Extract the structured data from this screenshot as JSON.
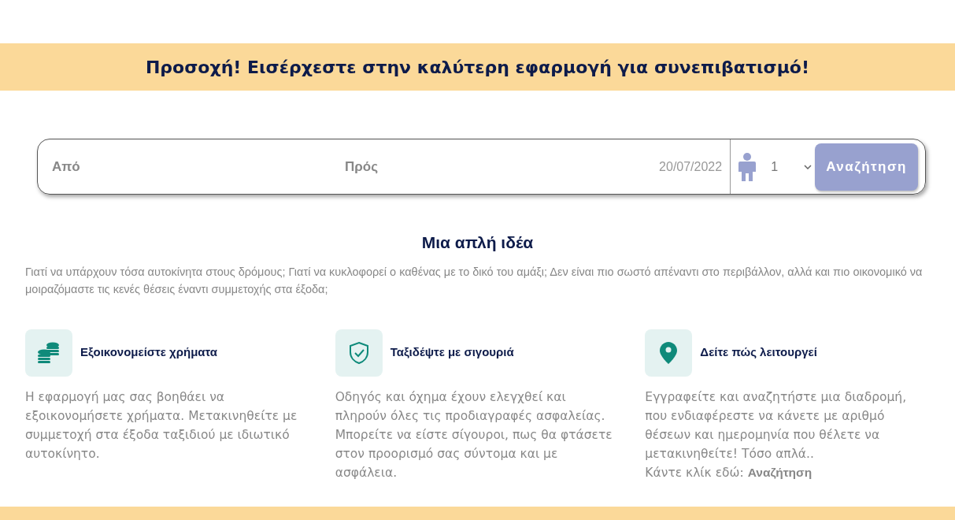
{
  "banner": {
    "text": "Προσοχή! Εισέρχεστε στην καλύτερη εφαρμογή για συνεπιβατισμό!"
  },
  "search": {
    "from_placeholder": "Από",
    "to_placeholder": "Πρός",
    "date": "20/07/2022",
    "passengers": "1",
    "button": "Αναζήτηση"
  },
  "intro": {
    "title": "Μια απλή ιδέα",
    "text": "Γιατί να υπάρχουν τόσα αυτοκίνητα στους δρόμους; Γιατί να κυκλοφορεί ο καθένας με το δικό του αμάξι; Δεν είναι πιο σωστό απέναντι στο περιβάλλον, αλλά και πιο οικονομικό να μοιραζόμαστε τις κενές θέσεις έναντι συμμετοχής στα έξοδα;"
  },
  "features": [
    {
      "kind": "coins",
      "title": "Εξοικονομείστε χρήματα",
      "body": "Η εφαρμογή μας σας βοηθάει να εξοικονομήσετε χρήματα. Μετακινηθείτε με συμμετοχή στα έξοδα ταξιδιού με ιδιωτικό αυτοκίνητο."
    },
    {
      "kind": "shield",
      "title": "Ταξιδέψτε με σιγουριά",
      "body": "Οδηγός και όχημα έχουν ελεγχθεί και πληρούν όλες τις προδιαγραφές ασφαλείας. Μπορείτε να είστε σίγουροι, πως θα φτάσετε στον προορισμό σας σύντομα και με ασφάλεια."
    },
    {
      "kind": "pin",
      "title": "Δείτε πώς λειτουργεί",
      "body": "Εγγραφείτε και αναζητήστε μια διαδρομή, που ενδιαφέρεστε να κάνετε με αριθμό θέσεων και ημερομηνία που θέλετε να μετακινηθείτε! Τόσο απλά..",
      "cta": {
        "text": "Κάντε κλίκ εδώ:",
        "link": "Αναζήτηση"
      }
    }
  ]
}
